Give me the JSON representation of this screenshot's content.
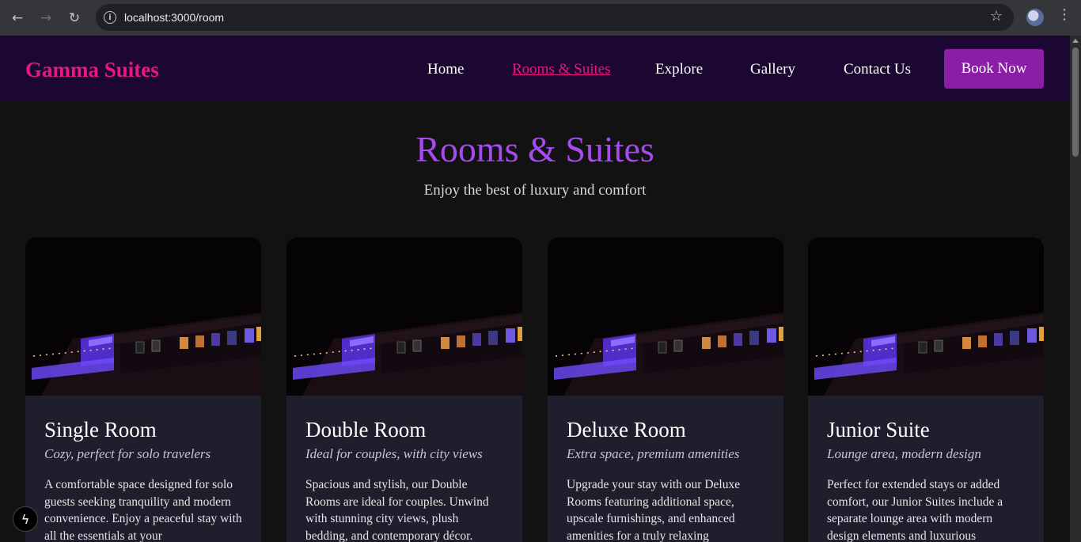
{
  "browser": {
    "url": "localhost:3000/room",
    "back_icon": "←",
    "forward_icon": "→",
    "reload_icon": "↻",
    "info_icon": "i",
    "star_icon": "☆",
    "menu_icon": "⋮"
  },
  "header": {
    "logo": "Gamma Suites",
    "nav": [
      "Home",
      "Rooms & Suites",
      "Explore",
      "Gallery",
      "Contact Us"
    ],
    "active_nav": "Rooms & Suites",
    "book_button": "Book Now"
  },
  "page": {
    "title": "Rooms & Suites",
    "subtitle": "Enjoy the best of luxury and comfort"
  },
  "rooms": [
    {
      "name": "Single Room",
      "tagline": "Cozy, perfect for solo travelers",
      "description": "A comfortable space designed for solo guests seeking tranquility and modern convenience. Enjoy a peaceful stay with all the essentials at your"
    },
    {
      "name": "Double Room",
      "tagline": "Ideal for couples, with city views",
      "description": "Spacious and stylish, our Double Rooms are ideal for couples. Unwind with stunning city views, plush bedding, and contemporary décor."
    },
    {
      "name": "Deluxe Room",
      "tagline": "Extra space, premium amenities",
      "description": "Upgrade your stay with our Deluxe Rooms featuring additional space, upscale furnishings, and enhanced amenities for a truly relaxing"
    },
    {
      "name": "Junior Suite",
      "tagline": "Lounge area, modern design",
      "description": "Perfect for extended stays or added comfort, our Junior Suites include a separate lounge area with modern design elements and luxurious"
    }
  ],
  "dev_indicator_icon": "ϟ",
  "colors": {
    "header_bg": "#1c0733",
    "logo": "#e8197a",
    "active_nav": "#e8197a",
    "title": "#a64bf0",
    "button": "#8a1fa6",
    "card_bg": "#1e1e2c"
  }
}
